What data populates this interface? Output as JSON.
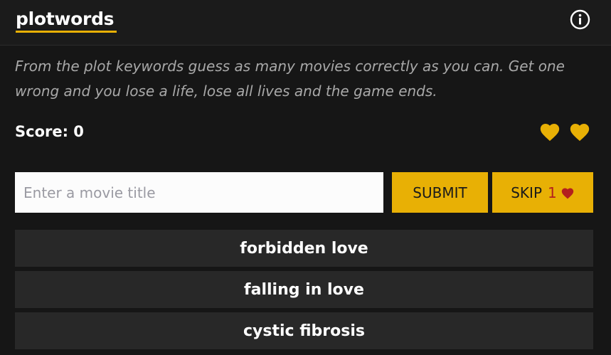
{
  "app": {
    "title": "plotwords",
    "info_icon": "info-circle-icon"
  },
  "colors": {
    "accent": "#e8b005",
    "background": "#161616",
    "header": "#1b1b1b",
    "keyword_bg": "#282828",
    "description": "#a8a8a8",
    "skip_count": "#b3201e"
  },
  "intro": {
    "text": "From the plot keywords guess as many movies correctly as you can. Get one wrong and you lose a life, lose all lives and the game ends."
  },
  "score": {
    "label": "Score: 0"
  },
  "lives": {
    "count": 2,
    "icon": "heart-icon"
  },
  "guess": {
    "placeholder": "Enter a movie title",
    "value": ""
  },
  "buttons": {
    "submit_label": "SUBMIT",
    "skip_label": "SKIP",
    "skip_cost": "1",
    "skip_icon": "heart-icon"
  },
  "keywords": [
    "forbidden love",
    "falling in love",
    "cystic fibrosis"
  ]
}
